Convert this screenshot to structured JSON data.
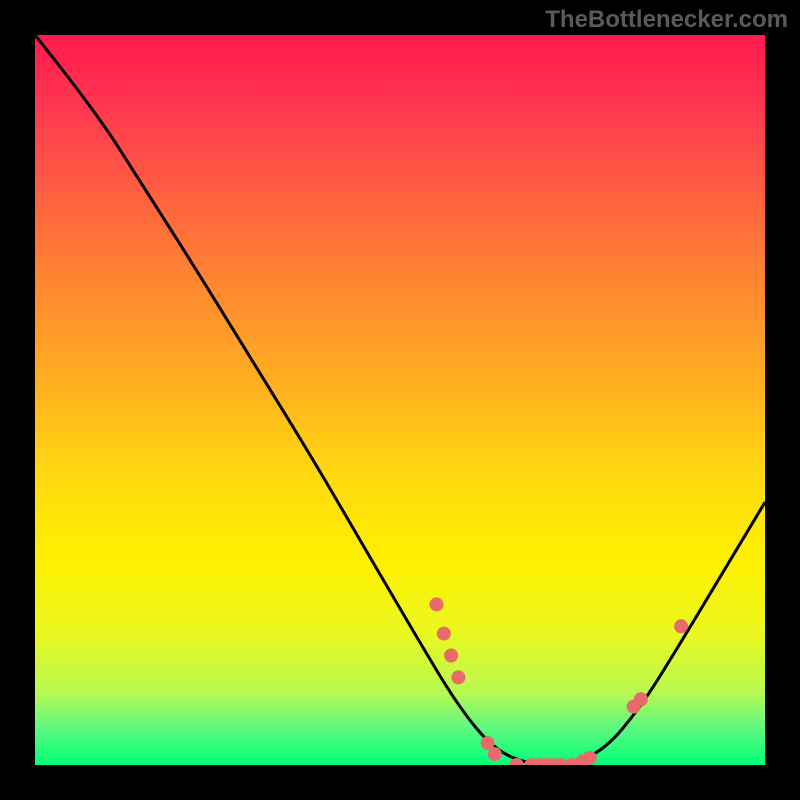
{
  "attribution": "TheBottlenecker.com",
  "chart_data": {
    "type": "line",
    "title": "",
    "xlabel": "",
    "ylabel": "",
    "xlim": [
      0,
      100
    ],
    "ylim": [
      0,
      100
    ],
    "curve": [
      {
        "x": 0,
        "y": 100
      },
      {
        "x": 8,
        "y": 90
      },
      {
        "x": 15,
        "y": 79
      },
      {
        "x": 22,
        "y": 68
      },
      {
        "x": 30,
        "y": 55
      },
      {
        "x": 38,
        "y": 42
      },
      {
        "x": 45,
        "y": 30
      },
      {
        "x": 52,
        "y": 18
      },
      {
        "x": 58,
        "y": 8
      },
      {
        "x": 63,
        "y": 2
      },
      {
        "x": 68,
        "y": 0
      },
      {
        "x": 73,
        "y": 0
      },
      {
        "x": 78,
        "y": 2
      },
      {
        "x": 83,
        "y": 8
      },
      {
        "x": 88,
        "y": 16
      },
      {
        "x": 94,
        "y": 26
      },
      {
        "x": 100,
        "y": 36
      }
    ],
    "markers": [
      {
        "x": 55,
        "y": 22
      },
      {
        "x": 56,
        "y": 18
      },
      {
        "x": 57,
        "y": 15
      },
      {
        "x": 58,
        "y": 12
      },
      {
        "x": 62,
        "y": 3
      },
      {
        "x": 63,
        "y": 1.5
      },
      {
        "x": 66,
        "y": 0
      },
      {
        "x": 68,
        "y": 0
      },
      {
        "x": 69,
        "y": 0
      },
      {
        "x": 70,
        "y": 0
      },
      {
        "x": 71,
        "y": 0
      },
      {
        "x": 72,
        "y": 0
      },
      {
        "x": 73.5,
        "y": 0
      },
      {
        "x": 75,
        "y": 0.5
      },
      {
        "x": 76,
        "y": 1
      },
      {
        "x": 82,
        "y": 8
      },
      {
        "x": 83,
        "y": 9
      },
      {
        "x": 88.5,
        "y": 19
      }
    ],
    "marker_color": "#e86a6a",
    "curve_color": "#000000"
  }
}
